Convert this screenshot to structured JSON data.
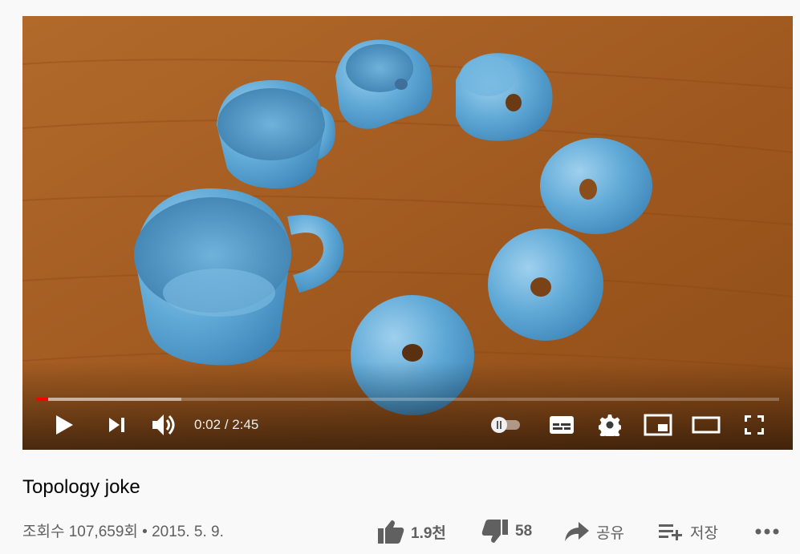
{
  "player": {
    "time_current": "0:02",
    "time_separator": " / ",
    "time_duration": "2:45",
    "progress_played": 0.016,
    "progress_loaded": 0.195,
    "autoplay_on": false,
    "colors": {
      "played": "#ff0000",
      "table": "#a35a22",
      "ceramic": "#5fa8d3"
    },
    "icons": [
      "play-icon",
      "next-icon",
      "volume-icon",
      "autoplay-toggle-icon",
      "subtitles-icon",
      "settings-icon",
      "miniplayer-icon",
      "theater-mode-icon",
      "fullscreen-icon"
    ]
  },
  "video": {
    "title": "Topology joke",
    "views_text": "조회수 107,659회",
    "separator": " • ",
    "date": "2015. 5. 9."
  },
  "actions": {
    "like_count": "1.9천",
    "dislike_count": "58",
    "share_label": "공유",
    "save_label": "저장",
    "icons": [
      "thumb-up-icon",
      "thumb-down-icon",
      "share-icon",
      "playlist-add-icon",
      "more-icon"
    ]
  }
}
